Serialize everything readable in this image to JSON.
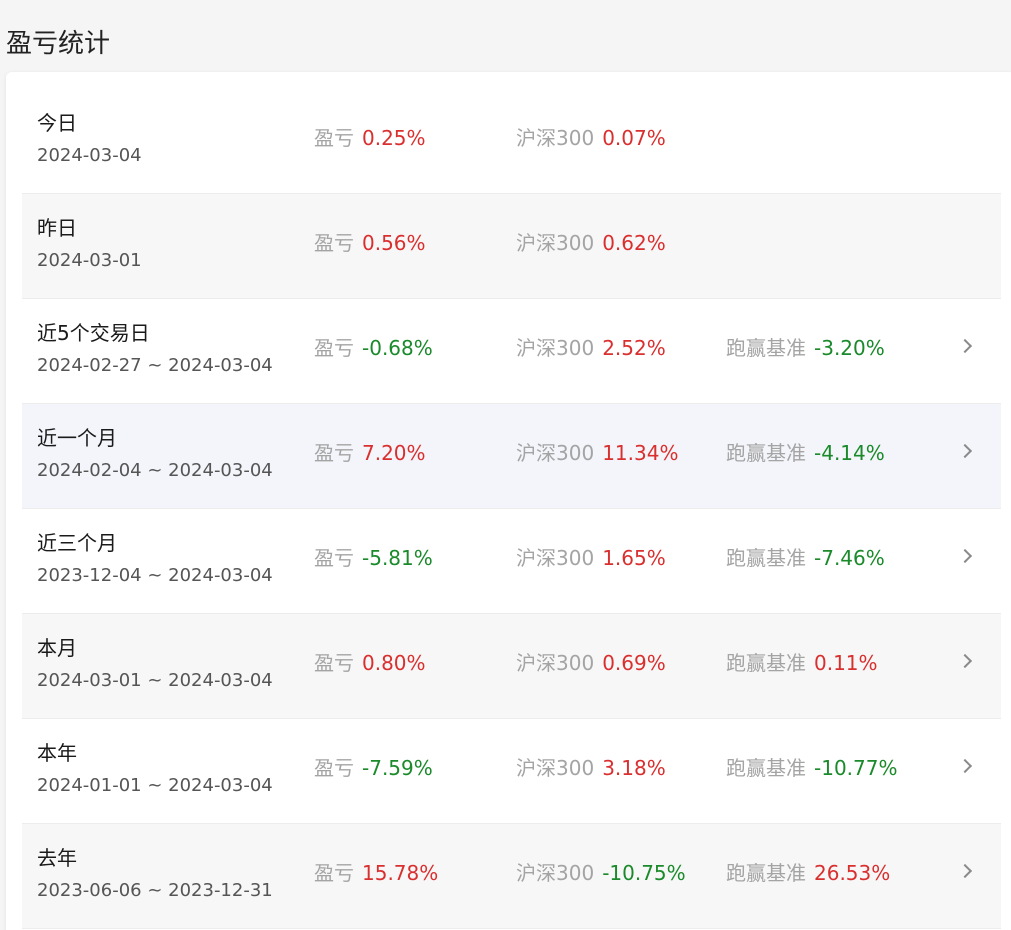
{
  "page": {
    "title": "盈亏统计"
  },
  "labels": {
    "pnl": "盈亏",
    "benchmark": "沪深300",
    "beat": "跑赢基准"
  },
  "colors": {
    "positive": "#d92f2f",
    "negative": "#1a8a2a",
    "label_gray": "#a4a4a4"
  },
  "rows": [
    {
      "label": "今日",
      "date": "2024-03-04",
      "pnl": "0.25%",
      "benchmark": "0.07%",
      "beat": null,
      "has_chevron": false
    },
    {
      "label": "昨日",
      "date": "2024-03-01",
      "pnl": "0.56%",
      "benchmark": "0.62%",
      "beat": null,
      "has_chevron": false
    },
    {
      "label": "近5个交易日",
      "date": "2024-02-27 ~ 2024-03-04",
      "pnl": "-0.68%",
      "benchmark": "2.52%",
      "beat": "-3.20%",
      "has_chevron": true
    },
    {
      "label": "近一个月",
      "date": "2024-02-04 ~ 2024-03-04",
      "pnl": "7.20%",
      "benchmark": "11.34%",
      "beat": "-4.14%",
      "has_chevron": true
    },
    {
      "label": "近三个月",
      "date": "2023-12-04 ~ 2024-03-04",
      "pnl": "-5.81%",
      "benchmark": "1.65%",
      "beat": "-7.46%",
      "has_chevron": true
    },
    {
      "label": "本月",
      "date": "2024-03-01 ~ 2024-03-04",
      "pnl": "0.80%",
      "benchmark": "0.69%",
      "beat": "0.11%",
      "has_chevron": true
    },
    {
      "label": "本年",
      "date": "2024-01-01 ~ 2024-03-04",
      "pnl": "-7.59%",
      "benchmark": "3.18%",
      "beat": "-10.77%",
      "has_chevron": true
    },
    {
      "label": "去年",
      "date": "2023-06-06 ~ 2023-12-31",
      "pnl": "15.78%",
      "benchmark": "-10.75%",
      "beat": "26.53%",
      "has_chevron": true
    }
  ]
}
